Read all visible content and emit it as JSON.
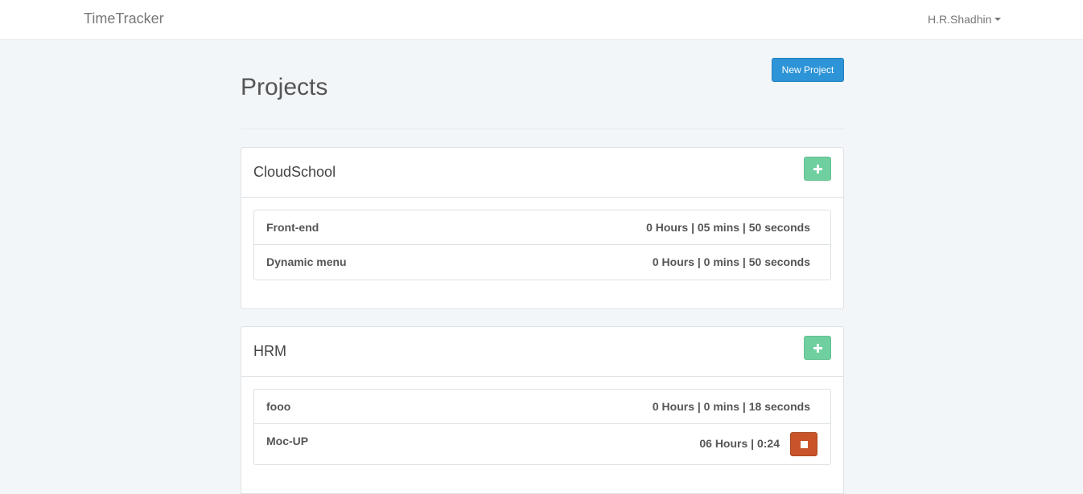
{
  "navbar": {
    "brand": "TimeTracker",
    "user": "H.R.Shadhin"
  },
  "page": {
    "title": "Projects",
    "new_project_label": "New Project"
  },
  "projects": [
    {
      "name": "CloudSchool",
      "tasks": [
        {
          "name": "Front-end",
          "time": "0 Hours | 05 mins | 50 seconds"
        },
        {
          "name": "Dynamic menu",
          "time": "0 Hours | 0 mins | 50 seconds"
        }
      ]
    },
    {
      "name": "HRM",
      "tasks": [
        {
          "name": "fooo",
          "time": "0 Hours | 0 mins | 18 seconds"
        },
        {
          "name": "Moc-UP",
          "time": "06 Hours | 0:24"
        }
      ]
    }
  ],
  "colors": {
    "primary": "#2d94d7",
    "success": "#6fcf9f",
    "danger": "#c9542a",
    "background": "#f3f6f9"
  },
  "icons": {
    "add": "plus-icon",
    "stop": "stop-icon",
    "dropdown": "caret-down-icon"
  }
}
